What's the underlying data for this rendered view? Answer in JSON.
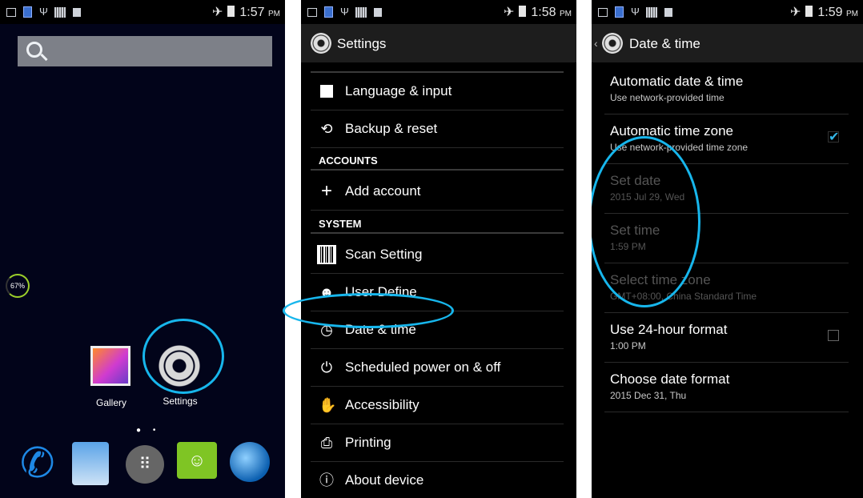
{
  "panel1": {
    "status_time": "1:57",
    "status_ampm": "PM",
    "battery_percent": "67%",
    "apps": [
      {
        "label": "Gallery"
      },
      {
        "label": "Settings"
      }
    ],
    "page_dots": "● •",
    "dock_icons": [
      "phone-icon",
      "contacts-icon",
      "all-apps-icon",
      "messaging-icon",
      "browser-icon"
    ]
  },
  "panel2": {
    "status_time": "1:58",
    "status_ampm": "PM",
    "title": "Settings",
    "items_top": [
      {
        "icon": "A",
        "label": "Language & input"
      },
      {
        "icon": "⟲",
        "label": "Backup & reset"
      }
    ],
    "section_accounts": "ACCOUNTS",
    "add_account": {
      "icon": "+",
      "label": "Add account"
    },
    "section_system": "SYSTEM",
    "items_system": [
      {
        "icon": "",
        "label": "Scan Setting"
      },
      {
        "icon": "☻",
        "label": "User Define"
      },
      {
        "icon": "◷",
        "label": "Date & time"
      },
      {
        "icon": "⏻",
        "label": "Scheduled power on & off"
      },
      {
        "icon": "✋",
        "label": "Accessibility"
      },
      {
        "icon": "⎙",
        "label": "Printing"
      },
      {
        "icon": "ⓘ",
        "label": "About device"
      }
    ]
  },
  "panel3": {
    "status_time": "1:59",
    "status_ampm": "PM",
    "title": "Date & time",
    "rows": [
      {
        "title": "Automatic date & time",
        "sub": "Use network-provided time"
      },
      {
        "title": "Automatic time zone",
        "sub": "Use network-provided time zone",
        "checked": true
      },
      {
        "title": "Set date",
        "sub": "2015 Jul 29, Wed"
      },
      {
        "title": "Set time",
        "sub": "1:59 PM"
      },
      {
        "title": "Select time zone",
        "sub": "GMT+08:00, China Standard Time"
      },
      {
        "title": "Use 24-hour format",
        "sub": "1:00 PM",
        "checked": false
      },
      {
        "title": "Choose date format",
        "sub": "2015 Dec 31, Thu"
      }
    ]
  },
  "colors": {
    "annotation": "#17b6ec",
    "home_background": "#02041a",
    "checkbox_accent": "#33b5e5"
  }
}
